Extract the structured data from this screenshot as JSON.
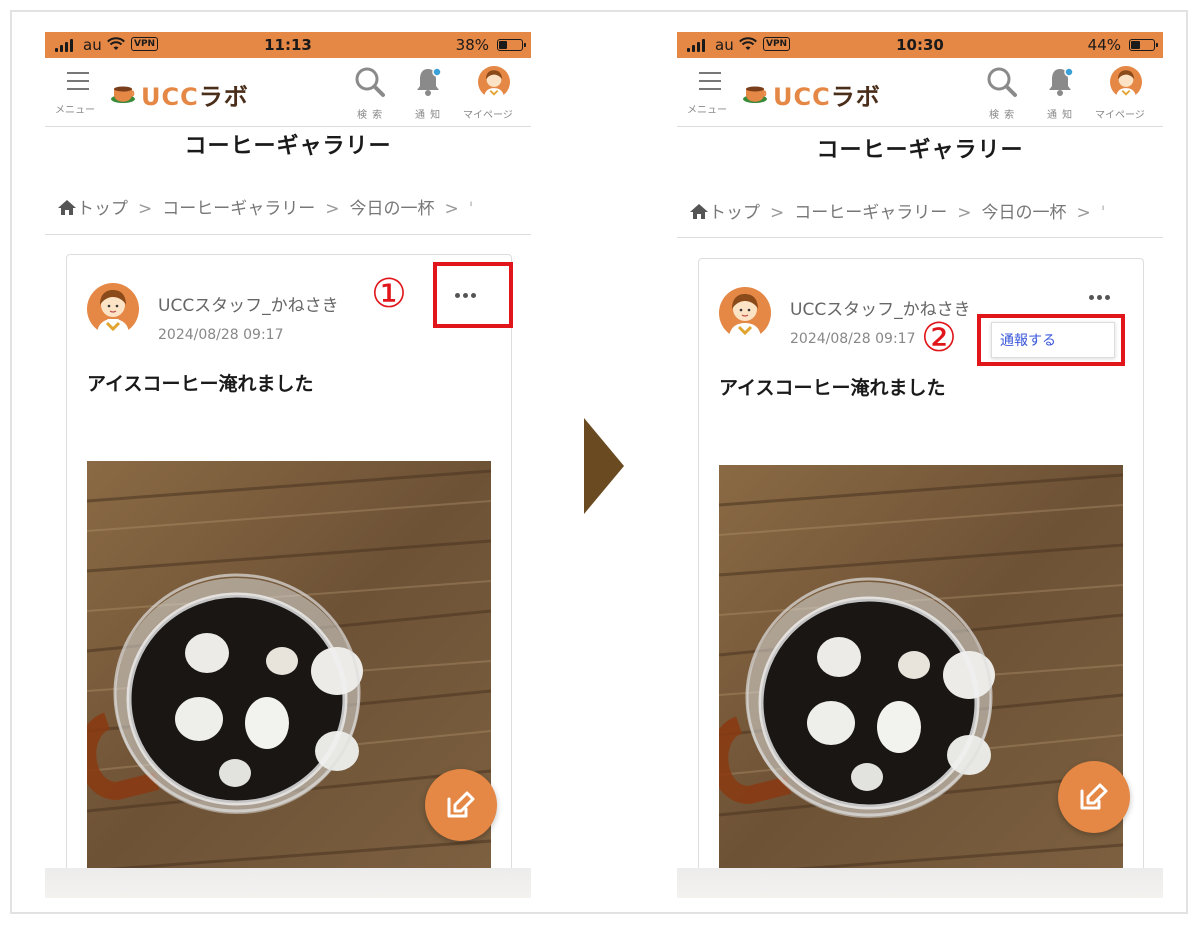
{
  "colors": {
    "accent": "#e58745",
    "brand_dark": "#4a2e1a",
    "highlight_red": "#e0161a",
    "link_blue": "#3a57d9",
    "arrow": "#6a4a20"
  },
  "screens": [
    {
      "status": {
        "carrier": "au",
        "vpn": "VPN",
        "time": "11:13",
        "battery": "38%",
        "battery_level": 0.38
      },
      "header": {
        "menu_label": "メニュー",
        "logo_latin": "UCC",
        "logo_kana": "ラボ",
        "search_label": "検 索",
        "notify_label": "通 知",
        "mypage_label": "マイページ"
      },
      "page_title": "コーヒーギャラリー",
      "breadcrumb": {
        "home": "トップ",
        "sep": ">",
        "item1": "コーヒーギャラリー",
        "item2": "今日の一杯",
        "cut": "'"
      },
      "post": {
        "username": "UCCスタッフ_かねさき",
        "timestamp": "2024/08/28 09:17",
        "title": "アイスコーヒー淹れました"
      },
      "step_marker": "①"
    },
    {
      "status": {
        "carrier": "au",
        "vpn": "VPN",
        "time": "10:30",
        "battery": "44%",
        "battery_level": 0.44
      },
      "header": {
        "menu_label": "メニュー",
        "logo_latin": "UCC",
        "logo_kana": "ラボ",
        "search_label": "検 索",
        "notify_label": "通 知",
        "mypage_label": "マイページ"
      },
      "page_title": "コーヒーギャラリー",
      "breadcrumb": {
        "home": "トップ",
        "sep": ">",
        "item1": "コーヒーギャラリー",
        "item2": "今日の一杯",
        "cut": "'"
      },
      "post": {
        "username": "UCCスタッフ_かねさき",
        "timestamp": "2024/08/28 09:17",
        "title": "アイスコーヒー淹れました"
      },
      "report_menu": {
        "report_label": "通報する"
      },
      "step_marker": "②"
    }
  ],
  "icons": [
    "hamburger-icon",
    "coffee-cup-logo-icon",
    "search-icon",
    "bell-icon",
    "avatar-icon",
    "home-icon",
    "more-icon",
    "edit-icon",
    "right-triangle-arrow-icon"
  ]
}
